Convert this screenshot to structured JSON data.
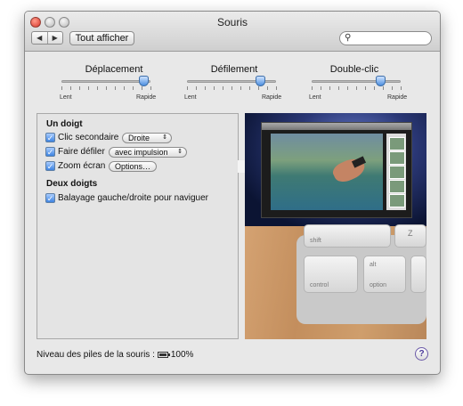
{
  "window": {
    "title": "Souris"
  },
  "toolbar": {
    "back_label": "◀",
    "forward_label": "▶",
    "show_all_label": "Tout afficher",
    "search_value": ""
  },
  "sliders": [
    {
      "label": "Déplacement",
      "min_label": "Lent",
      "max_label": "Rapide",
      "value_fraction": 0.92
    },
    {
      "label": "Défilement",
      "min_label": "Lent",
      "max_label": "Rapide",
      "value_fraction": 0.82
    },
    {
      "label": "Double-clic",
      "min_label": "Lent",
      "max_label": "Rapide",
      "value_fraction": 0.77
    }
  ],
  "one_finger": {
    "heading": "Un doigt",
    "secondary_click": {
      "label": "Clic secondaire",
      "checked": true,
      "option": "Droite"
    },
    "scroll": {
      "label": "Faire défiler",
      "checked": true,
      "option": "avec impulsion"
    },
    "zoom": {
      "label": "Zoom écran",
      "checked": true,
      "button": "Options…"
    }
  },
  "two_fingers": {
    "heading": "Deux doigts",
    "swipe": {
      "label": "Balayage gauche/droite pour naviguer",
      "checked": true
    }
  },
  "preview_keys": {
    "shift": "shift",
    "z": "Z",
    "control": "control",
    "alt": "alt",
    "option": "option"
  },
  "footer": {
    "battery_label": "Niveau des piles de la souris :",
    "battery_value": "100%",
    "battery_level": 1.0,
    "help_label": "?"
  },
  "colors": {
    "accent": "#3d83e0",
    "window_bg": "#e8e8e8"
  }
}
